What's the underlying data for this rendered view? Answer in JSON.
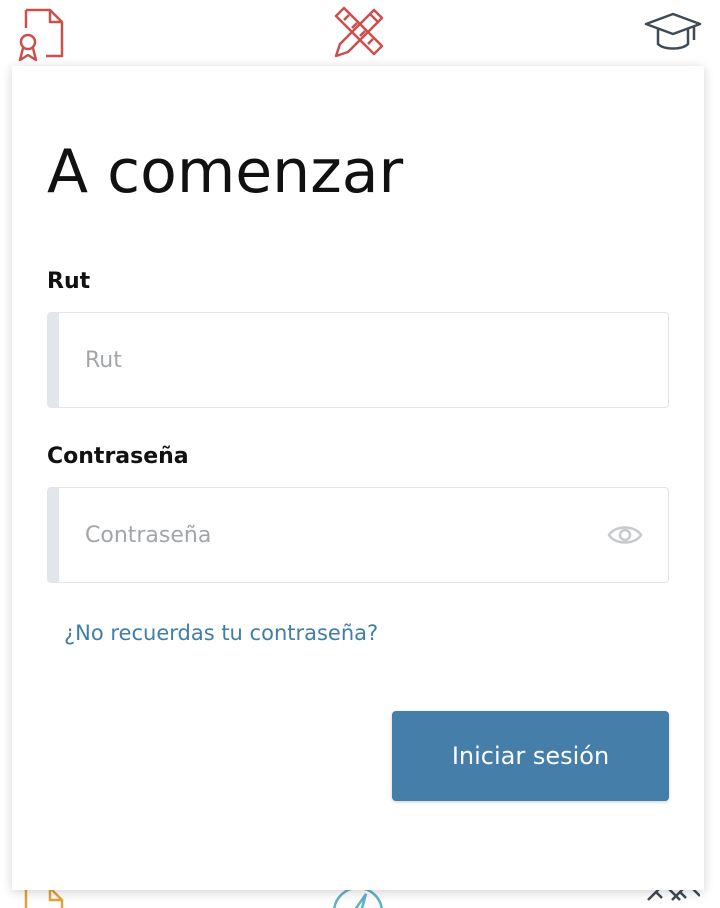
{
  "login": {
    "title": "A comenzar",
    "rut_label": "Rut",
    "rut_placeholder": "Rut",
    "password_label": "Contraseña",
    "password_placeholder": "Contraseña",
    "forgot_link": "¿No recuerdas tu contraseña?",
    "submit_label": "Iniciar sesión"
  },
  "icons": {
    "top": [
      "certificate-icon",
      "pencil-ruler-icon",
      "graduation-cap-icon"
    ],
    "bottom": [
      "certificate-icon",
      "compass-icon",
      "ruler-icon"
    ],
    "password_toggle": "eye-icon"
  },
  "colors": {
    "accent": "#457ea8",
    "link": "#3f7ea6",
    "icon_red": "#c9504c",
    "icon_dark": "#3f4a54",
    "icon_orange": "#e0a33a",
    "icon_teal": "#5fb1c4",
    "placeholder": "#a3a6a9"
  }
}
